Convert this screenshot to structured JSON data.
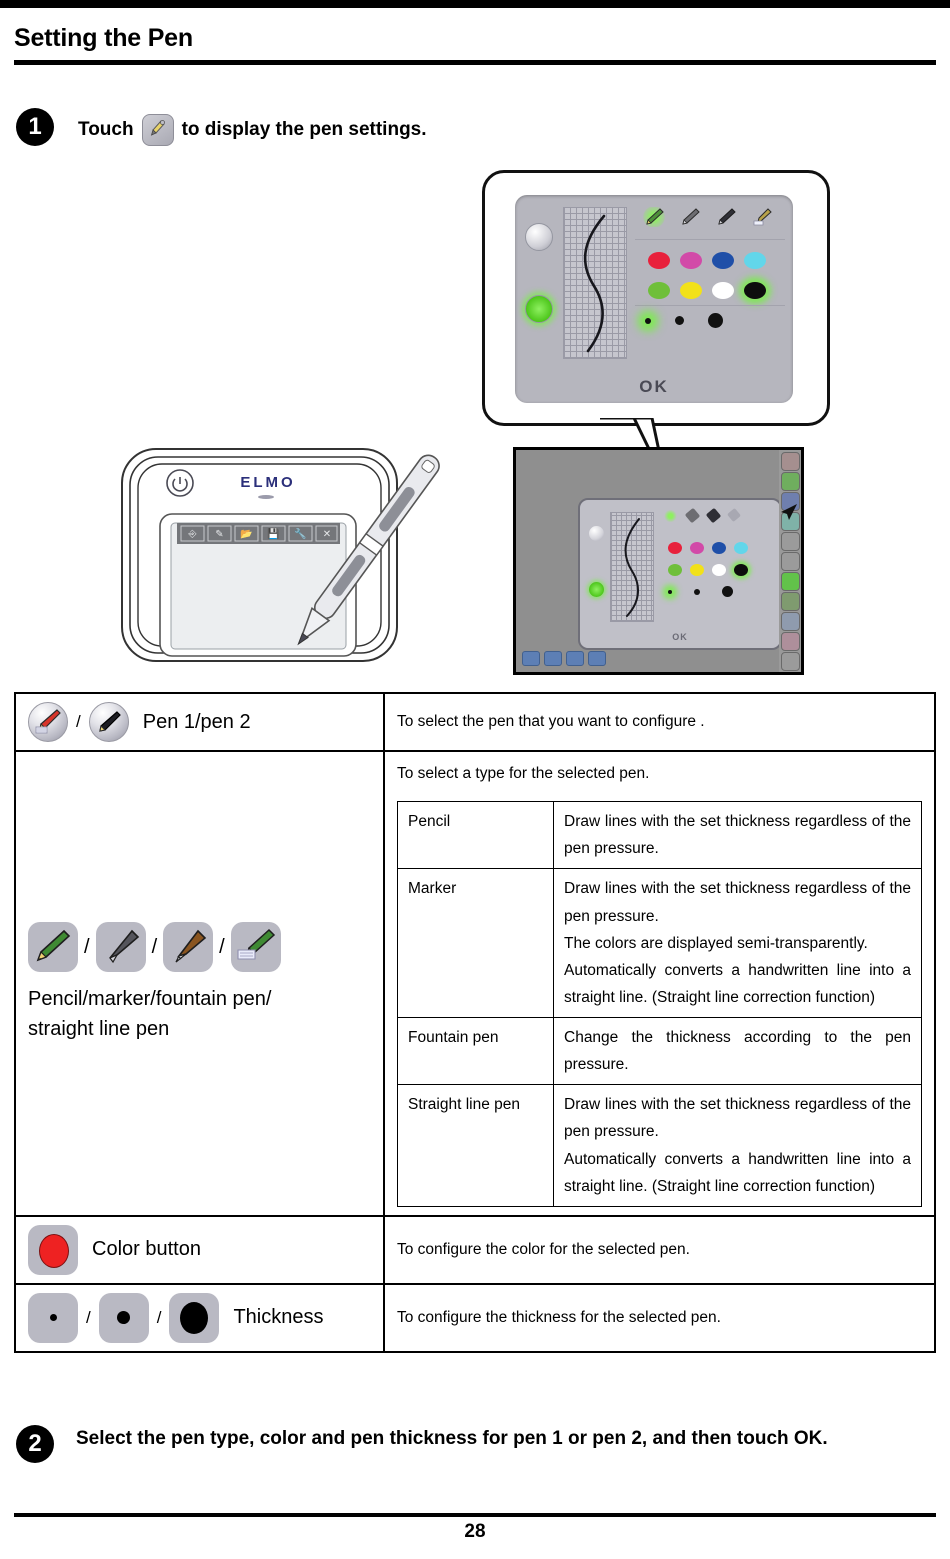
{
  "document": {
    "title": "Setting the Pen",
    "page_number": "28"
  },
  "steps": [
    {
      "number": "1",
      "text_before": "Touch",
      "text_after": "to display the pen settings.",
      "icon": "pen-settings-icon"
    },
    {
      "number": "2",
      "text": "Select the pen type, color and pen thickness for pen 1 or pen 2, and then touch OK."
    }
  ],
  "figure": {
    "dialog": {
      "ok_label": "OK",
      "pen_selectors": [
        {
          "name": "pen-1-selector",
          "selected": false
        },
        {
          "name": "pen-2-selector",
          "selected": true
        }
      ],
      "pen_types": [
        {
          "name": "pencil",
          "selected": true
        },
        {
          "name": "marker",
          "selected": false
        },
        {
          "name": "fountain-pen",
          "selected": false
        },
        {
          "name": "straight-line-pen",
          "selected": false
        }
      ],
      "colors": [
        {
          "name": "red",
          "hex": "#e8213c",
          "selected": false
        },
        {
          "name": "magenta",
          "hex": "#d council",
          "selected": false
        },
        {
          "name": "blue",
          "hex": "#1f4fa8",
          "selected": false
        },
        {
          "name": "cyan",
          "hex": "#62d6ea",
          "selected": false
        },
        {
          "name": "green",
          "hex": "#6fbf3a",
          "selected": false
        },
        {
          "name": "yellow",
          "hex": "#f2e119",
          "selected": false
        },
        {
          "name": "white",
          "hex": "#ffffff",
          "selected": false
        },
        {
          "name": "black",
          "hex": "#0d0d0d",
          "selected": true
        }
      ],
      "thicknesses": [
        {
          "name": "thin",
          "selected": true
        },
        {
          "name": "medium",
          "selected": false
        },
        {
          "name": "thick",
          "selected": false
        }
      ]
    },
    "tablet": {
      "brand": "ELMO",
      "toolbar_icons": [
        "pointer-icon",
        "edit-icon",
        "open-file-icon",
        "save-file-icon",
        "settings-wrench-icon",
        "close-icon"
      ]
    },
    "screen_capture": {
      "dialog_ok_label": "OK"
    }
  },
  "table": {
    "rows": [
      {
        "id": "pen-select-row",
        "left": {
          "icons": [
            "pen-1-icon",
            "pen-2-icon"
          ],
          "separator": "/",
          "label": "Pen 1/pen 2"
        },
        "right": "To select the pen that you want to configure ."
      },
      {
        "id": "pen-type-row",
        "left": {
          "icons": [
            "pencil-icon",
            "marker-icon",
            "fountain-pen-icon",
            "straight-line-pen-icon"
          ],
          "separator": "/",
          "label_line1": "Pencil/marker/fountain pen/",
          "label_line2": "straight line pen"
        },
        "right_intro": "To select a type for the selected pen.",
        "subtable": [
          {
            "name": "Pencil",
            "desc": "Draw lines with the set thickness regardless of the pen pressure."
          },
          {
            "name": "Marker",
            "desc": "Draw lines with the set thickness regardless of the pen pressure.\nThe colors are displayed semi-transparently.\nAutomatically converts a handwritten line into a straight line. (Straight line correction function)"
          },
          {
            "name": "Fountain pen",
            "desc": "Change the thickness according to the pen pressure."
          },
          {
            "name": "Straight line pen",
            "desc": "Draw lines with the set thickness regardless of the pen pressure.\nAutomatically converts a handwritten line into a straight line. (Straight line correction function)"
          }
        ]
      },
      {
        "id": "color-button-row",
        "left": {
          "icons": [
            "color-button-icon"
          ],
          "label": "Color button"
        },
        "right": "To configure the color for the selected pen."
      },
      {
        "id": "thickness-row",
        "left": {
          "icons": [
            "thickness-thin-icon",
            "thickness-medium-icon",
            "thickness-thick-icon"
          ],
          "separator": "/",
          "label": "Thickness"
        },
        "right": "To configure the thickness for the selected pen."
      }
    ]
  }
}
